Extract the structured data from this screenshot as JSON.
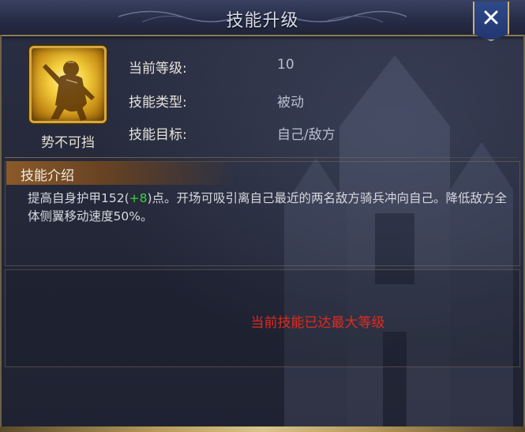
{
  "dialog": {
    "title": "技能升级"
  },
  "skill": {
    "name": "势不可挡",
    "icon": "charging-knight-icon"
  },
  "info": [
    {
      "label": "当前等级:",
      "value": "10"
    },
    {
      "label": "技能类型:",
      "value": "被动"
    },
    {
      "label": "技能目标:",
      "value": "自己/敌方"
    }
  ],
  "intro": {
    "header": "技能介绍",
    "desc_part1": "提高自身护甲152(",
    "desc_bonus": "+8",
    "desc_part2": ")点。开场可吸引离自己最近的两名敌方骑兵冲向自己。降低敌方全体侧翼移动速度50%。"
  },
  "upgrade": {
    "status": "当前技能已达最大等级"
  },
  "colors": {
    "accent_gold": "#d8a73e",
    "bonus_green": "#3fcf3f",
    "max_red": "#e02a1f"
  }
}
